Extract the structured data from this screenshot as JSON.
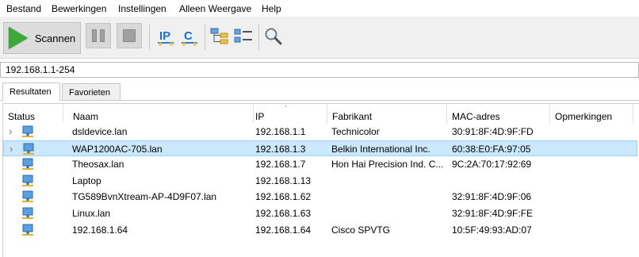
{
  "menu": [
    "Bestand",
    "Bewerkingen",
    "Instellingen",
    "Alleen Weergave",
    "Help"
  ],
  "toolbar": {
    "scan_label": "Scannen",
    "scan_icon": "play-icon",
    "pause_icon": "pause-icon",
    "stop_icon": "stop-icon",
    "ip_icon_label": "IP",
    "c_icon_label": "C",
    "accent_color": "#1a6fd4"
  },
  "address": {
    "value": "192.168.1.1-254"
  },
  "tabs": [
    {
      "label": "Resultaten",
      "active": true
    },
    {
      "label": "Favorieten",
      "active": false
    }
  ],
  "table": {
    "columns": [
      "Status",
      "Naam",
      "IP",
      "Fabrikant",
      "MAC-adres",
      "Opmerkingen"
    ],
    "sort_column": "IP",
    "rows": [
      {
        "expandable": true,
        "selected": false,
        "name": "dsldevice.lan",
        "ip": "192.168.1.1",
        "vendor": "Technicolor",
        "mac": "30:91:8F:4D:9F:FD",
        "notes": ""
      },
      {
        "expandable": true,
        "selected": true,
        "name": "WAP1200AC-705.lan",
        "ip": "192.168.1.3",
        "vendor": "Belkin International Inc.",
        "mac": "60:38:E0:FA:97:05",
        "notes": ""
      },
      {
        "expandable": false,
        "selected": false,
        "name": "Theosax.lan",
        "ip": "192.168.1.7",
        "vendor": "Hon Hai Precision Ind. C...",
        "mac": "9C:2A:70:17:92:69",
        "notes": ""
      },
      {
        "expandable": false,
        "selected": false,
        "name": "Laptop",
        "ip": "192.168.1.13",
        "vendor": "",
        "mac": "",
        "notes": ""
      },
      {
        "expandable": false,
        "selected": false,
        "name": "TG589BvnXtream-AP-4D9F07.lan",
        "ip": "192.168.1.62",
        "vendor": "",
        "mac": "32:91:8F:4D:9F:06",
        "notes": ""
      },
      {
        "expandable": false,
        "selected": false,
        "name": "Linux.lan",
        "ip": "192.168.1.63",
        "vendor": "",
        "mac": "32:91:8F:4D:9F:FE",
        "notes": ""
      },
      {
        "expandable": false,
        "selected": false,
        "name": "192.168.1.64",
        "ip": "192.168.1.64",
        "vendor": "Cisco SPVTG",
        "mac": "10:5F:49:93:AD:07",
        "notes": ""
      }
    ]
  }
}
